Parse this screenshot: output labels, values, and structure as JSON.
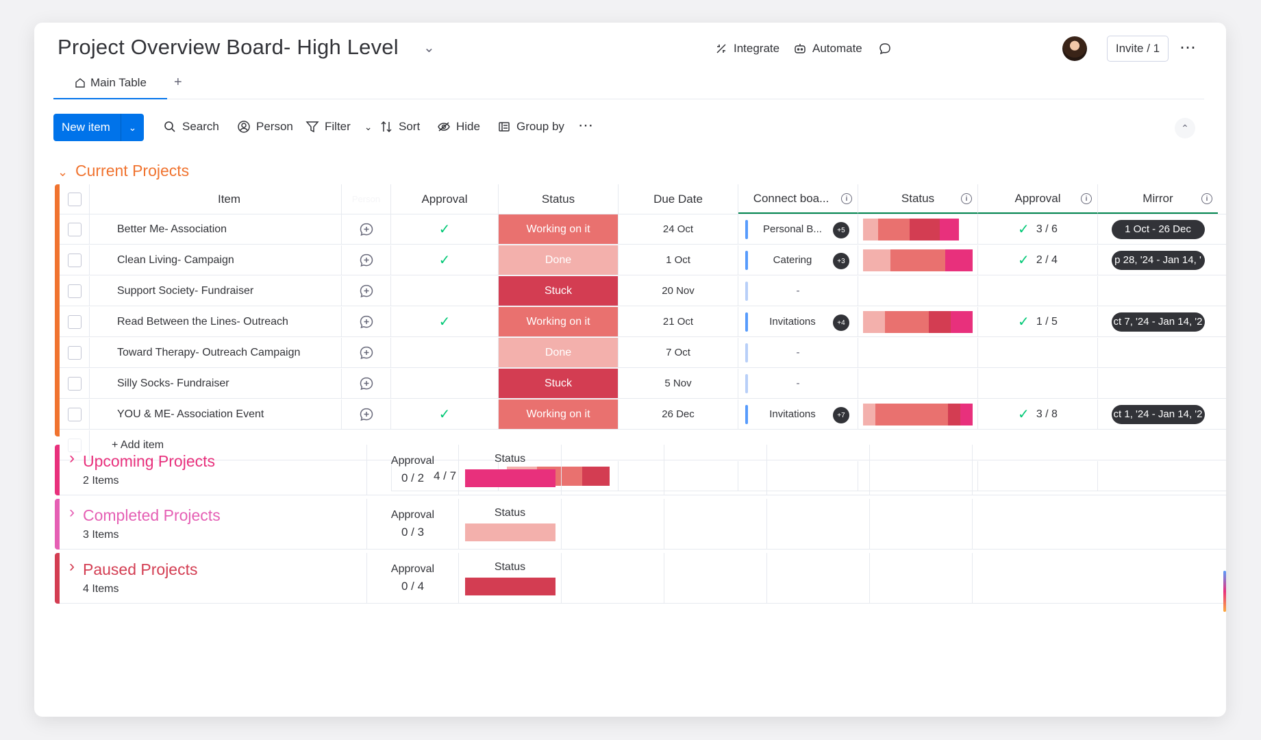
{
  "board": {
    "title": "Project Overview Board- High Level"
  },
  "header": {
    "integrate_label": "Integrate",
    "automate_label": "Automate",
    "invite_label": "Invite / 1"
  },
  "tabs": {
    "main_label": "Main Table",
    "add_label": "+"
  },
  "toolbar": {
    "new_item_label": "New item",
    "search_label": "Search",
    "person_label": "Person",
    "filter_label": "Filter",
    "sort_label": "Sort",
    "hide_label": "Hide",
    "group_by_label": "Group by"
  },
  "colors": {
    "working": "#e9716f",
    "done": "#f3b0ac",
    "stuck": "#d33d52",
    "upcoming": "#e8307c",
    "completed": "#f3b0ac",
    "paused": "#d33d52",
    "accent": "#0073ea"
  },
  "current_group": {
    "title": "Current Projects",
    "color": "#f0732f",
    "columns": [
      "Item",
      "Person",
      "Approval",
      "Status",
      "Due Date",
      "Connect boa...",
      "Status",
      "Approval",
      "Mirror"
    ],
    "add_item_label": "+ Add item",
    "summary_approval": "4 / 7",
    "rows": [
      {
        "item": "Better Me- Association",
        "approved": true,
        "status": "Working on it",
        "due": "24 Oct",
        "connect": "Personal B...",
        "connect_badge": "+5",
        "approval2": "3 / 6",
        "mirror": "1 Oct - 26 Dec"
      },
      {
        "item": "Clean Living- Campaign",
        "approved": true,
        "status": "Done",
        "due": "1 Oct",
        "connect": "Catering",
        "connect_badge": "+3",
        "approval2": "2 / 4",
        "mirror": "p 28, '24 - Jan 14, '"
      },
      {
        "item": "Support Society- Fundraiser",
        "approved": false,
        "status": "Stuck",
        "due": "20 Nov",
        "connect": "-",
        "connect_badge": "",
        "approval2": "",
        "mirror": ""
      },
      {
        "item": "Read Between the Lines- Outreach",
        "approved": true,
        "status": "Working on it",
        "due": "21 Oct",
        "connect": "Invitations",
        "connect_badge": "+4",
        "approval2": "1 / 5",
        "mirror": "ct 7, '24 - Jan 14, '2"
      },
      {
        "item": "Toward Therapy- Outreach Campaign",
        "approved": false,
        "status": "Done",
        "due": "7 Oct",
        "connect": "-",
        "connect_badge": "",
        "approval2": "",
        "mirror": ""
      },
      {
        "item": "Silly Socks- Fundraiser",
        "approved": false,
        "status": "Stuck",
        "due": "5 Nov",
        "connect": "-",
        "connect_badge": "",
        "approval2": "",
        "mirror": ""
      },
      {
        "item": "YOU & ME- Association Event",
        "approved": true,
        "status": "Working on it",
        "due": "26 Dec",
        "connect": "Invitations",
        "connect_badge": "+7",
        "approval2": "3 / 8",
        "mirror": "ct 1, '24 - Jan 14, '2"
      }
    ]
  },
  "groups": [
    {
      "title": "Upcoming Projects",
      "count": "2 Items",
      "approval_label": "Approval",
      "approval_value": "0 / 2",
      "status_label": "Status",
      "color": "#e8307c"
    },
    {
      "title": "Completed Projects",
      "count": "3 Items",
      "approval_label": "Approval",
      "approval_value": "0 / 3",
      "status_label": "Status",
      "color": "#e55fb4"
    },
    {
      "title": "Paused Projects",
      "count": "4 Items",
      "approval_label": "Approval",
      "approval_value": "0 / 4",
      "status_label": "Status",
      "color": "#d33d52"
    }
  ]
}
